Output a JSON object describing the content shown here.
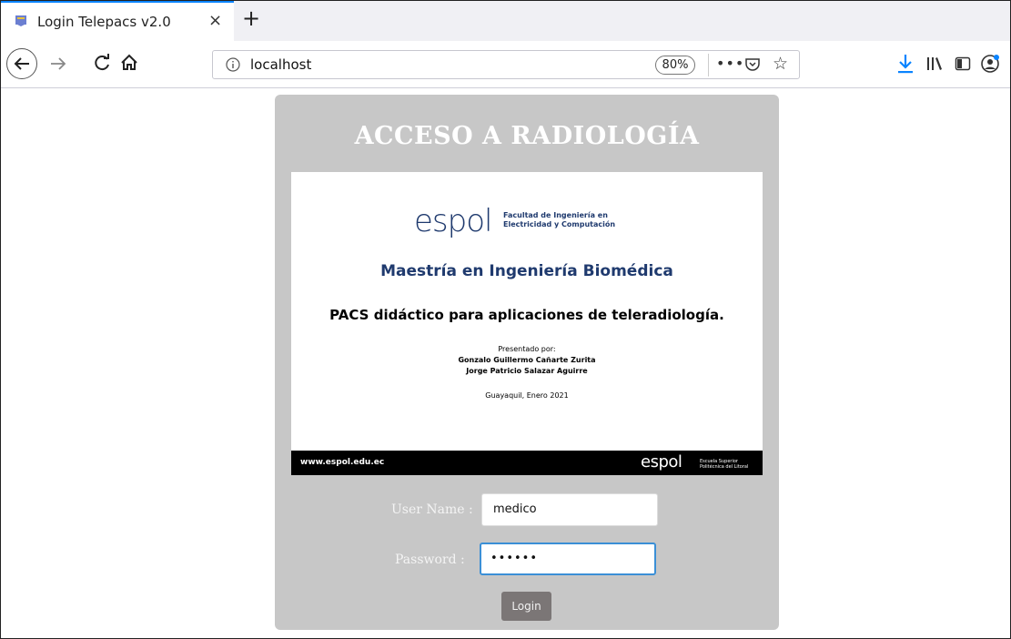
{
  "browser": {
    "tab": {
      "title": "Login Telepacs v2.0",
      "close_glyph": "×"
    },
    "new_tab_glyph": "+",
    "url": "localhost",
    "zoom": "80%",
    "more_glyph": "•••",
    "star_glyph": "☆",
    "icons": [
      "favicon-icon",
      "back-arrow-icon",
      "forward-arrow-icon",
      "reload-icon",
      "home-icon",
      "info-icon",
      "pocket-icon",
      "star-icon",
      "download-icon",
      "library-icon",
      "sidebar-icon",
      "account-icon",
      "mouse-pointer-icon"
    ]
  },
  "page": {
    "title": "ACCESO A RADIOLOGÍA",
    "slide": {
      "logo_word": "espol",
      "faculty": "Facultad de Ingeniería en\nElectricidad y Computación",
      "program": "Maestría en Ingeniería Biomédica",
      "thesis": "PACS didáctico para aplicaciones de teleradiología.",
      "presented_by": "Presentado por:",
      "author1": "Gonzalo Guillermo Cañarte Zurita",
      "author2": "Jorge Patricio Salazar Aguirre",
      "date": "Guayaquil, Enero 2021",
      "footer_url": "www.espol.edu.ec",
      "footer_logo": "espol",
      "footer_sub": "Escuela Superior\nPolitécnica del Litoral"
    },
    "form": {
      "user_label": "User Name :",
      "user_value": "medico",
      "password_label": "Password  :",
      "password_value": "••••••",
      "login_label": "Login"
    }
  },
  "colors": {
    "tab_accent": "#0a84ff",
    "box_bg": "#c7c7c7",
    "brand_blue": "#1f3a6e",
    "button_bg": "#7b7676",
    "focus_border": "#3b8fd6"
  }
}
